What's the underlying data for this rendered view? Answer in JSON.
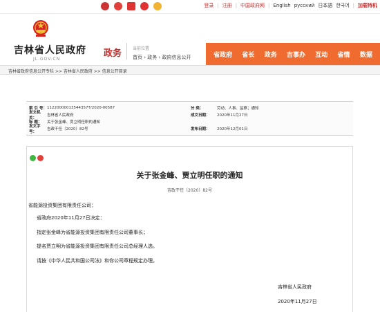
{
  "top_links": {
    "login": "登录",
    "register": "注册",
    "gov_portal": "中国政府网",
    "english": "English",
    "russian": "русский",
    "japanese": "日本語",
    "korean": "한국어",
    "subscribe": "加载特机"
  },
  "header": {
    "site_name": "吉林省人民政府",
    "domain": "JL.GOV.CN",
    "section": "政务",
    "location_label": "当前位置",
    "breadcrumb": "首页 › 政务 › 政府信息公开"
  },
  "nav": {
    "items": [
      "省政府",
      "省长",
      "政务",
      "吉事办",
      "互动",
      "省情",
      "数据"
    ]
  },
  "crumb_bar": "吉林省政府信息公开专栏 >> 吉林省人民政府 >> 信息公开目录",
  "meta": {
    "index_label": "索 引 号：",
    "index_value": "11220000013544357T/2020-00587",
    "category_label": "分 类：",
    "category_value": "劳动、人事、监察；通知",
    "issuer_label": "发文机关：",
    "issuer_value": "吉林省人民政府",
    "written_label": "成文日期：",
    "written_value": "2020年11月27日",
    "title_label": "标 题：",
    "title_value": "关于张金峰、贾立明任职的通知",
    "docno_label": "发文字号：",
    "docno_value": "吉政干任〔2020〕82号",
    "published_label": "发布日期：",
    "published_value": "2020年12月01日"
  },
  "article": {
    "title": "关于张金峰、贾立明任职的通知",
    "doc_number": "吉政干任〔2020〕82号",
    "salutation": "省能源投资集团有限责任公司：",
    "paragraphs": [
      "省政府2020年11月27日决定：",
      "指定张金峰为省能源投资集团有限责任公司董事长；",
      "提名贾立明为省能源投资集团有限责任公司总经理人选。",
      "请按《中华人民共和国公司法》和你公司章程规定办理。"
    ],
    "signature": "吉林省人民政府",
    "sign_date": "2020年11月27日"
  },
  "colors": {
    "accent_red": "#c52d2d",
    "nav_orange": "#ef6b2f"
  }
}
